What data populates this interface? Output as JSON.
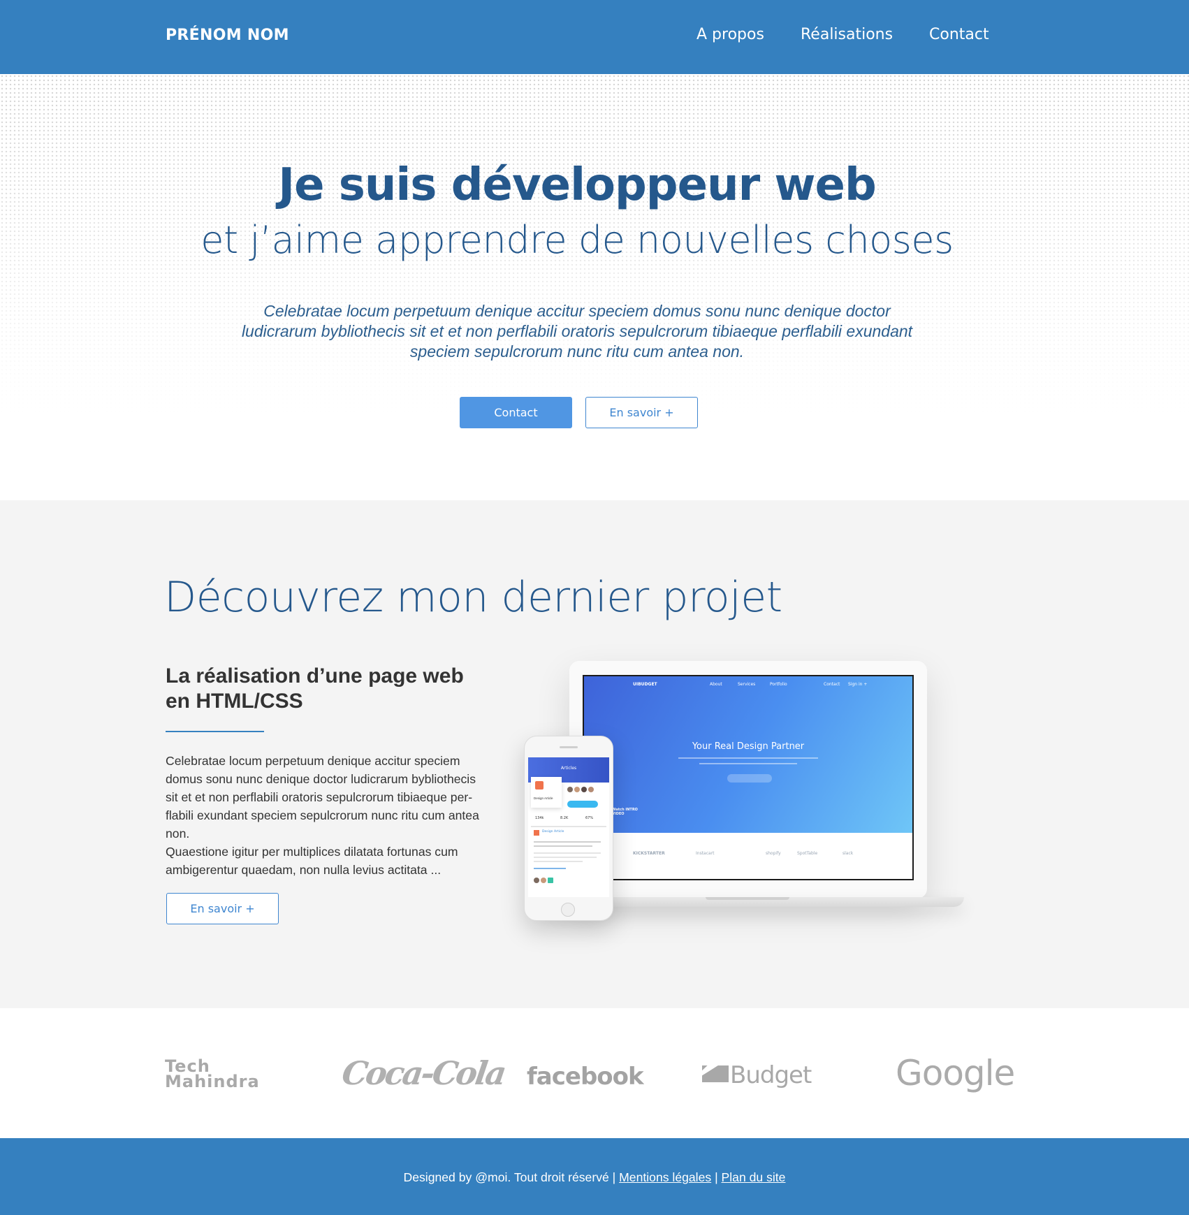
{
  "header": {
    "brand": "PRÉNOM NOM",
    "nav": [
      "A propos",
      "Réalisations",
      "Contact"
    ]
  },
  "hero": {
    "title": "Je suis développeur web",
    "subtitle": "et j’aime apprendre de nouvelles choses",
    "text": "Celebratae locum perpetuum denique accitur speciem domus sonu nunc denique doctor ludicrarum bybliothecis sit et et non perflabili oratoris sepulcrorum tibiaeque perflabili exundant speciem sepulcrorum nunc ritu cum antea non.",
    "contact_button": "Contact",
    "more_button": "En savoir +"
  },
  "project": {
    "title": "Découvrez mon dernier projet",
    "heading": "La réalisation d’une page web en HTML/CSS",
    "body": "Celebratae locum perpetuum denique accitur speciem domus sonu nunc denique doctor ludicrarum bybliothecis sit et et non perflabili oratoris sepulcrorum tibiaeque per-flabili exundant speciem sepulcrorum nunc ritu cum antea non.",
    "body2": "Quaestione igitur per multiplices dilatata fortunas cum ambigerentur quaedam, non nulla levius actitata ...",
    "more_button": "En savoir +",
    "mockup": {
      "screen_brand": "UIBUDGET",
      "screen_nav": [
        "About",
        "Services",
        "Portfolio",
        "Contact",
        "Sign in +"
      ],
      "screen_headline": "Your Real Design Partner",
      "screen_side": "Watch INTRO VIDEO",
      "screen_logos": [
        "KICKSTARTER",
        "Instacart",
        "shopify",
        "SpotTable",
        "slack"
      ],
      "phone_title": "Articles",
      "phone_card": "Design Article",
      "phone_stats": [
        "134k",
        "8.2K",
        "67%"
      ],
      "phone_article": "Design Article"
    }
  },
  "logos": {
    "tech_line1": "Tech",
    "tech_line2": "Mahindra",
    "coke": "Coca-Cola",
    "facebook": "facebook",
    "budget": "Budget",
    "google": "Google"
  },
  "footer": {
    "prefix": "Designed by @moi. Tout droit réservé |",
    "legal": "Mentions légales",
    "separator": "|",
    "sitemap": "Plan du site"
  },
  "colors": {
    "primary": "#3580bf",
    "title": "#25588c",
    "button": "#5096e3"
  }
}
